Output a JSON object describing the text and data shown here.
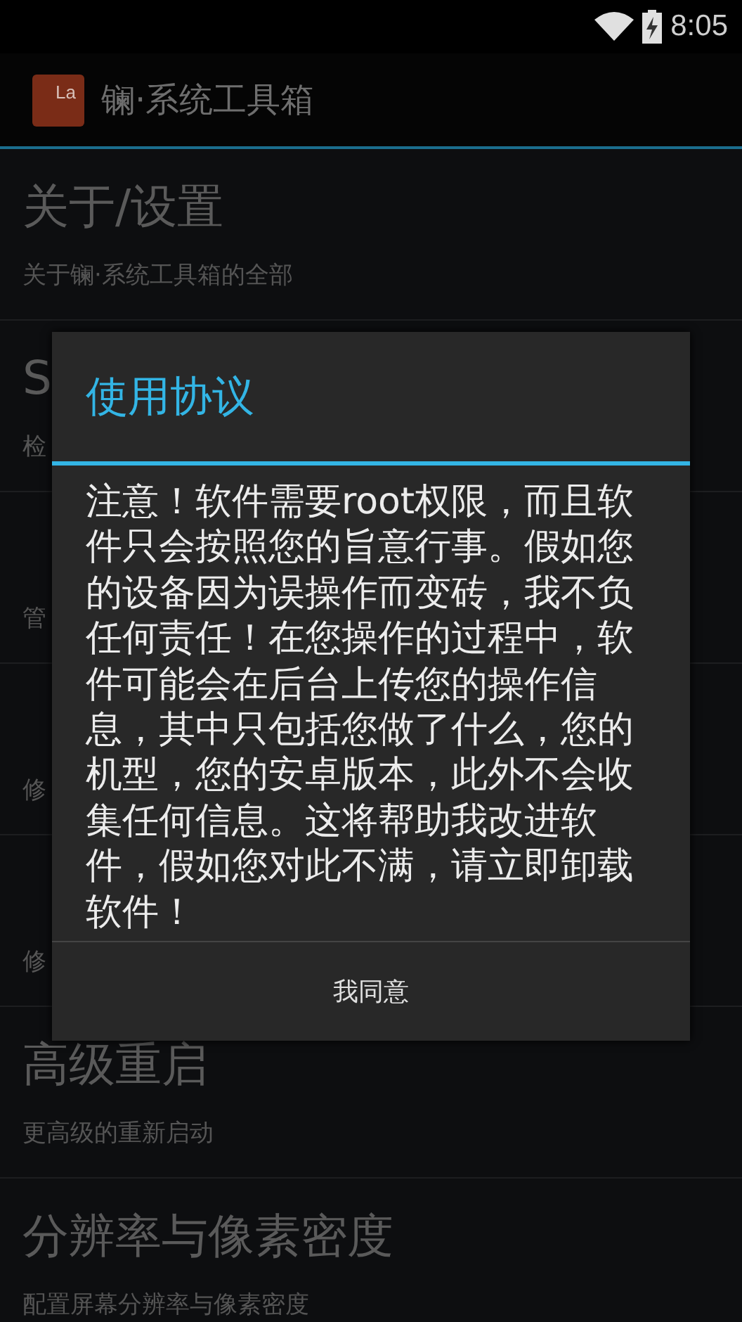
{
  "status_bar": {
    "time": "8:05"
  },
  "action_bar": {
    "title": "镧·系统工具箱",
    "logo_text": "La"
  },
  "list": [
    {
      "title": "关于/设置",
      "subtitle": "关于镧·系统工具箱的全部"
    },
    {
      "title": "S",
      "subtitle": "检"
    },
    {
      "subtitle": "管"
    },
    {
      "subtitle": "修"
    },
    {
      "subtitle": "修"
    },
    {
      "title": "高级重启",
      "subtitle": "更高级的重新启动"
    },
    {
      "title": "分辨率与像素密度",
      "subtitle": "配置屏幕分辨率与像素密度"
    }
  ],
  "dialog": {
    "title": "使用协议",
    "message": "注意！软件需要root权限，而且软件只会按照您的旨意行事。假如您的设备因为误操作而变砖，我不负任何责任！在您操作的过程中，软件可能会在后台上传您的操作信息，其中只包括您做了什么，您的机型，您的安卓版本，此外不会收集任何信息。这将帮助我改进软件，假如您对此不满，请立即卸载软件！",
    "buttons": [
      "我同意"
    ]
  }
}
